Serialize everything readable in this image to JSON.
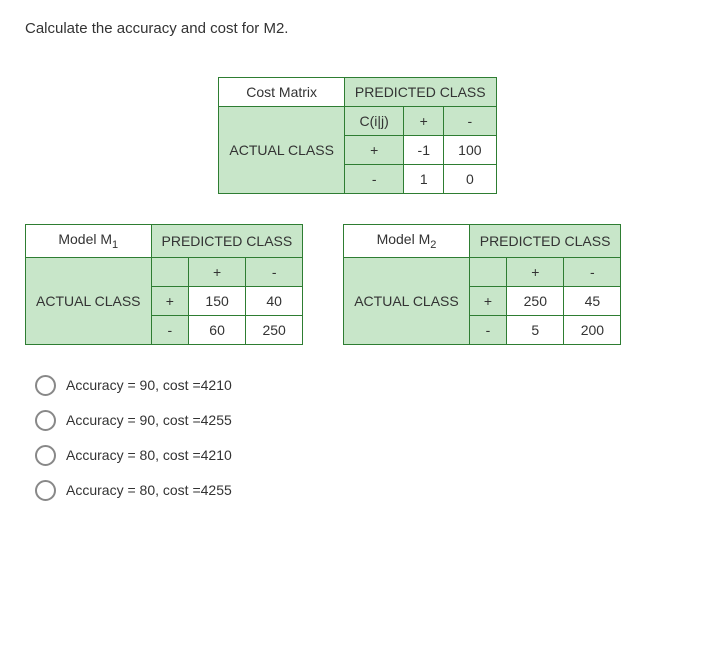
{
  "question": "Calculate the accuracy and cost for M2.",
  "cost_matrix": {
    "title": "Cost Matrix",
    "pred_label": "PREDICTED CLASS",
    "actual_label": "ACTUAL CLASS",
    "cij": "C(i|j)",
    "plus": "+",
    "minus": "-",
    "r1c1": "-1",
    "r1c2": "100",
    "r2c1": "1",
    "r2c2": "0"
  },
  "m1": {
    "title": "Model M",
    "sub": "1",
    "pred_label": "PREDICTED CLASS",
    "actual_label": "ACTUAL CLASS",
    "plus": "+",
    "minus": "-",
    "r1c1": "150",
    "r1c2": "40",
    "r2c1": "60",
    "r2c2": "250"
  },
  "m2": {
    "title": "Model M",
    "sub": "2",
    "pred_label": "PREDICTED CLASS",
    "actual_label": "ACTUAL CLASS",
    "plus": "+",
    "minus": "-",
    "r1c1": "250",
    "r1c2": "45",
    "r2c1": "5",
    "r2c2": "200"
  },
  "options": {
    "a": "Accuracy = 90, cost =4210",
    "b": "Accuracy = 90, cost =4255",
    "c": "Accuracy = 80, cost =4210",
    "d": "Accuracy = 80, cost =4255"
  }
}
